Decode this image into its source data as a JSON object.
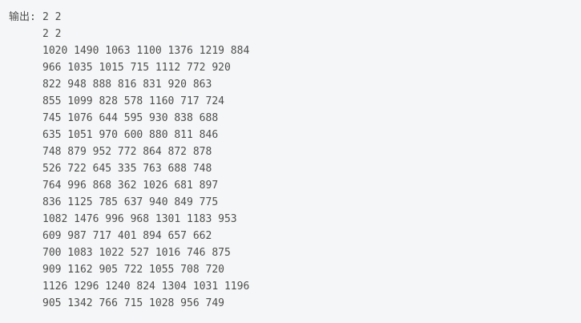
{
  "output": {
    "label": "输出:",
    "lines": [
      "2 2",
      "2 2",
      "1020 1490 1063 1100 1376 1219 884",
      "966 1035 1015 715 1112 772 920",
      "822 948 888 816 831 920 863",
      "855 1099 828 578 1160 717 724",
      "745 1076 644 595 930 838 688",
      "635 1051 970 600 880 811 846",
      "748 879 952 772 864 872 878",
      "526 722 645 335 763 688 748",
      "764 996 868 362 1026 681 897",
      "836 1125 785 637 940 849 775",
      "1082 1476 996 968 1301 1183 953",
      "609 987 717 401 894 657 662",
      "700 1083 1022 527 1016 746 875",
      "909 1162 905 722 1055 708 720",
      "1126 1296 1240 824 1304 1031 1196",
      "905 1342 766 715 1028 956 749"
    ]
  }
}
